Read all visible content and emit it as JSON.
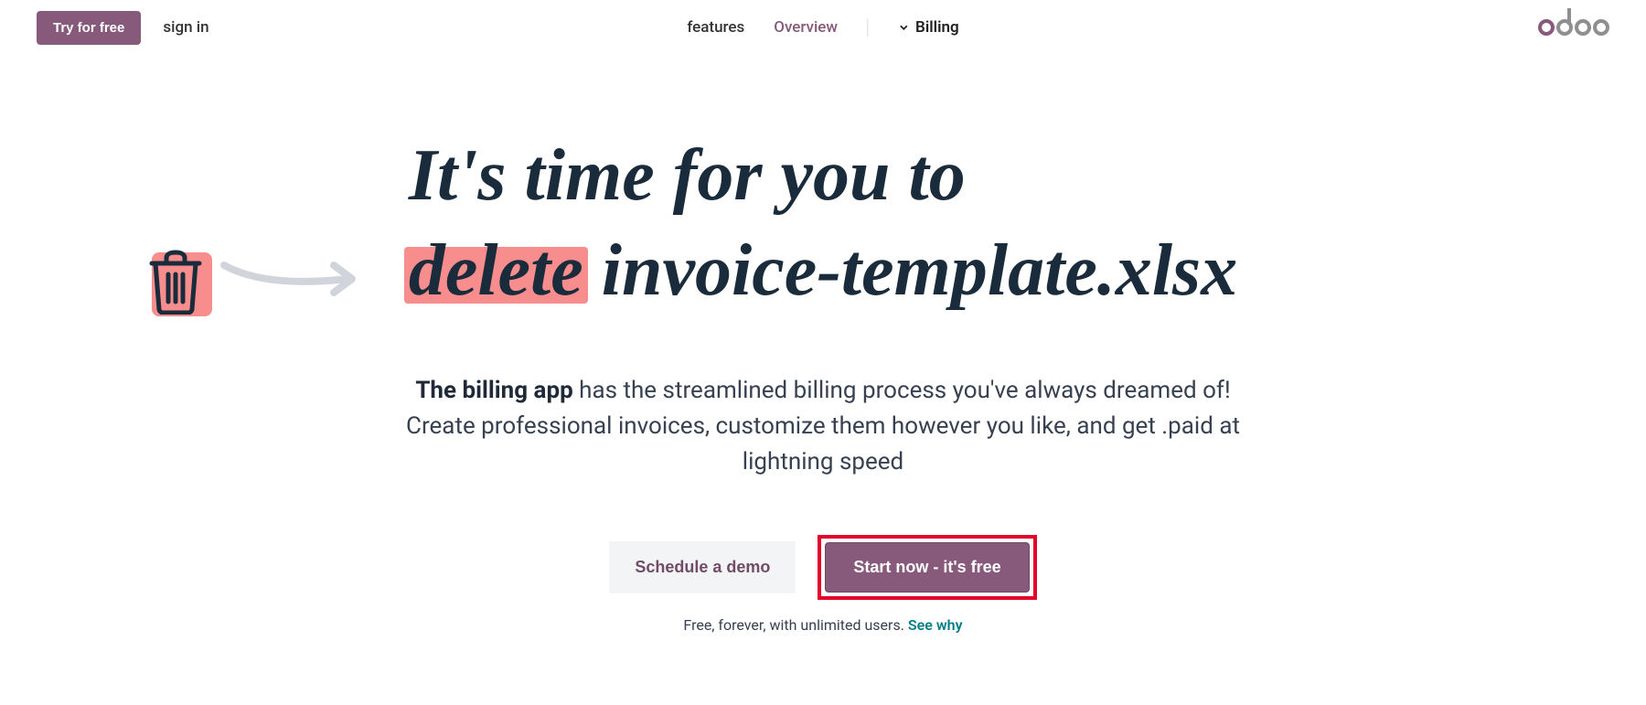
{
  "header": {
    "try_free_label": "Try for free",
    "sign_in_label": "sign in",
    "nav": {
      "features_label": "features",
      "overview_label": "Overview",
      "billing_label": "Billing"
    },
    "logo_text": "odoo"
  },
  "hero": {
    "title_line1": "It's time for you to",
    "title_highlight": "delete",
    "title_rest": " invoice-template.xlsx",
    "desc_bold": "The billing app",
    "desc_text": " has the streamlined billing process you've always dreamed of! Create professional invoices, customize them however you like, and get .paid at lightning speed"
  },
  "cta": {
    "schedule_label": "Schedule a demo",
    "start_label": "Start now - it's free"
  },
  "footer": {
    "text": "Free, forever, with unlimited users. ",
    "see_why_label": "See why"
  }
}
